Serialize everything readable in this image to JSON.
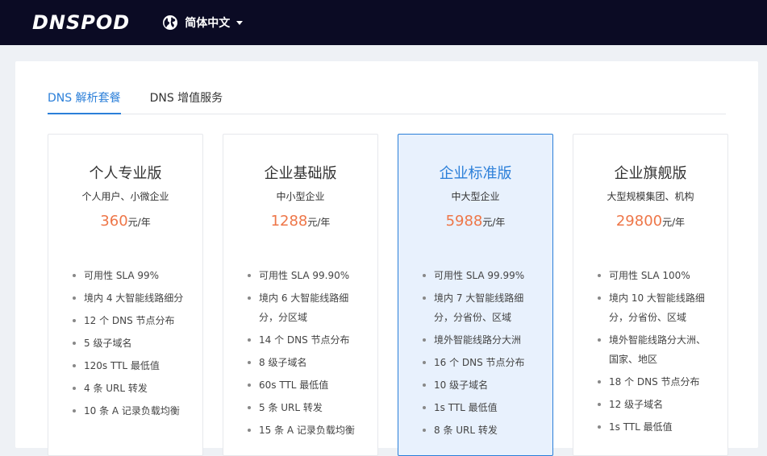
{
  "header": {
    "logo": "DNSPOD",
    "language": "简体中文"
  },
  "tabs": [
    {
      "label": "DNS 解析套餐",
      "active": true
    },
    {
      "label": "DNS 增值服务",
      "active": false
    }
  ],
  "plans": [
    {
      "title": "个人专业版",
      "subtitle": "个人用户、小微企业",
      "price": "360",
      "unit": "元/年",
      "features": [
        "可用性 SLA 99%",
        "境内 4 大智能线路细分",
        "12 个 DNS 节点分布",
        "5 级子域名",
        "120s TTL 最低值",
        "4 条 URL 转发",
        "10 条 A 记录负载均衡"
      ]
    },
    {
      "title": "企业基础版",
      "subtitle": "中小型企业",
      "price": "1288",
      "unit": "元/年",
      "features": [
        "可用性 SLA 99.90%",
        "境内 6 大智能线路细分，分区域",
        "14 个 DNS 节点分布",
        "8 级子域名",
        "60s TTL 最低值",
        "5 条 URL 转发",
        "15 条 A 记录负载均衡"
      ]
    },
    {
      "title": "企业标准版",
      "subtitle": "中大型企业",
      "price": "5988",
      "unit": "元/年",
      "featured": true,
      "features": [
        "可用性 SLA 99.99%",
        "境内 7 大智能线路细分，分省份、区域",
        "境外智能线路分大洲",
        "16 个 DNS 节点分布",
        "10 级子域名",
        "1s TTL 最低值",
        "8 条 URL 转发"
      ]
    },
    {
      "title": "企业旗舰版",
      "subtitle": "大型规模集团、机构",
      "price": "29800",
      "unit": "元/年",
      "features": [
        "可用性 SLA 100%",
        "境内 10 大智能线路细分，分省份、区域",
        "境外智能线路分大洲、国家、地区",
        "18 个 DNS 节点分布",
        "12 级子域名",
        "1s TTL 最低值"
      ]
    }
  ],
  "colors": {
    "header_bg": "#0b0b24",
    "accent": "#2b7fd9",
    "price": "#ee7648",
    "featured_bg": "#e8f1fd"
  }
}
